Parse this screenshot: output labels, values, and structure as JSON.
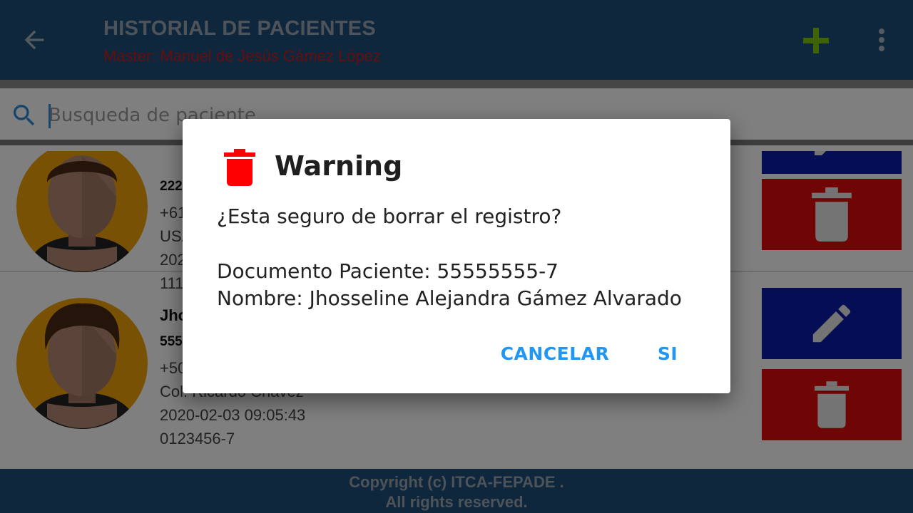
{
  "appbar": {
    "title": "HISTORIAL DE PACIENTES",
    "subtitle": "Master: Manuel de Jesús Gámez López"
  },
  "search": {
    "placeholder": "Busqueda de paciente"
  },
  "patients": [
    {
      "name": "",
      "document": "222",
      "phone": "+61",
      "address": "USA",
      "date": "202",
      "code": "111"
    },
    {
      "name": "Jho",
      "document": "555",
      "phone": "+50",
      "address": "Col. Ricardo Chavez",
      "date": "2020-02-03 09:05:43",
      "code": "0123456-7"
    }
  ],
  "footer": {
    "line1": "Copyright (c) ITCA-FEPADE .",
    "line2": "All rights reserved."
  },
  "dialog": {
    "title": "Warning",
    "question": "¿Esta seguro de borrar el registro?",
    "document_line": "Documento Paciente: 55555555-7",
    "name_line": "Nombre: Jhosseline Alejandra Gámez Alvarado",
    "cancel_label": "CANCELAR",
    "confirm_label": "SI"
  },
  "colors": {
    "appbar": "#1f4e79",
    "edit_button": "#0a1aa8",
    "delete_button": "#e00a0a",
    "dialog_button_text": "#2196f3",
    "subtitle": "#d11a1a",
    "add_icon": "#7ac70c"
  },
  "icons": [
    "back-arrow-icon",
    "add-icon",
    "more-vert-icon",
    "search-icon",
    "pencil-icon",
    "trash-icon"
  ]
}
